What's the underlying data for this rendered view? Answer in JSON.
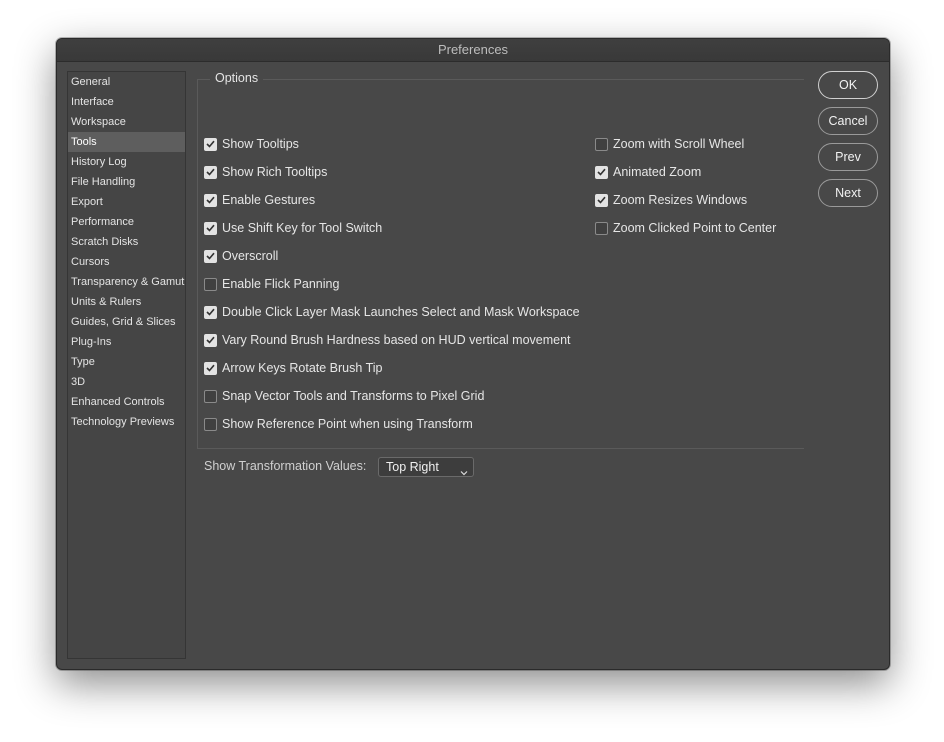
{
  "window": {
    "title": "Preferences"
  },
  "sidebar": {
    "selected": "Tools",
    "items": [
      "General",
      "Interface",
      "Workspace",
      "Tools",
      "History Log",
      "File Handling",
      "Export",
      "Performance",
      "Scratch Disks",
      "Cursors",
      "Transparency & Gamut",
      "Units & Rulers",
      "Guides, Grid & Slices",
      "Plug-Ins",
      "Type",
      "3D",
      "Enhanced Controls",
      "Technology Previews"
    ]
  },
  "options": {
    "legend": "Options",
    "left": [
      {
        "label": "Show Tooltips",
        "checked": true
      },
      {
        "label": "Show Rich Tooltips",
        "checked": true
      },
      {
        "label": "Enable Gestures",
        "checked": true
      },
      {
        "label": "Use Shift Key for Tool Switch",
        "checked": true
      },
      {
        "label": "Overscroll",
        "checked": true
      },
      {
        "label": "Enable Flick Panning",
        "checked": false
      },
      {
        "label": "Double Click Layer Mask Launches Select and Mask Workspace",
        "checked": true
      },
      {
        "label": "Vary Round Brush Hardness based on HUD vertical movement",
        "checked": true
      },
      {
        "label": "Arrow Keys Rotate Brush Tip",
        "checked": true
      },
      {
        "label": "Snap Vector Tools and Transforms to Pixel Grid",
        "checked": false
      },
      {
        "label": "Show Reference Point when using Transform",
        "checked": false
      }
    ],
    "right": [
      {
        "label": "Zoom with Scroll Wheel",
        "checked": false
      },
      {
        "label": "Animated Zoom",
        "checked": true
      },
      {
        "label": "Zoom Resizes Windows",
        "checked": true
      },
      {
        "label": "Zoom Clicked Point to Center",
        "checked": false
      }
    ],
    "transformation": {
      "label": "Show Transformation Values:",
      "value": "Top Right"
    }
  },
  "buttons": {
    "ok": "OK",
    "cancel": "Cancel",
    "prev": "Prev",
    "next": "Next"
  },
  "colors": {
    "window_bg": "#484848",
    "selected_bg": "#5e5e5e",
    "text": "#e6e6e6"
  },
  "icons": {
    "checkbox_check": "check-icon",
    "select_arrow": "chevron-down-icon"
  }
}
